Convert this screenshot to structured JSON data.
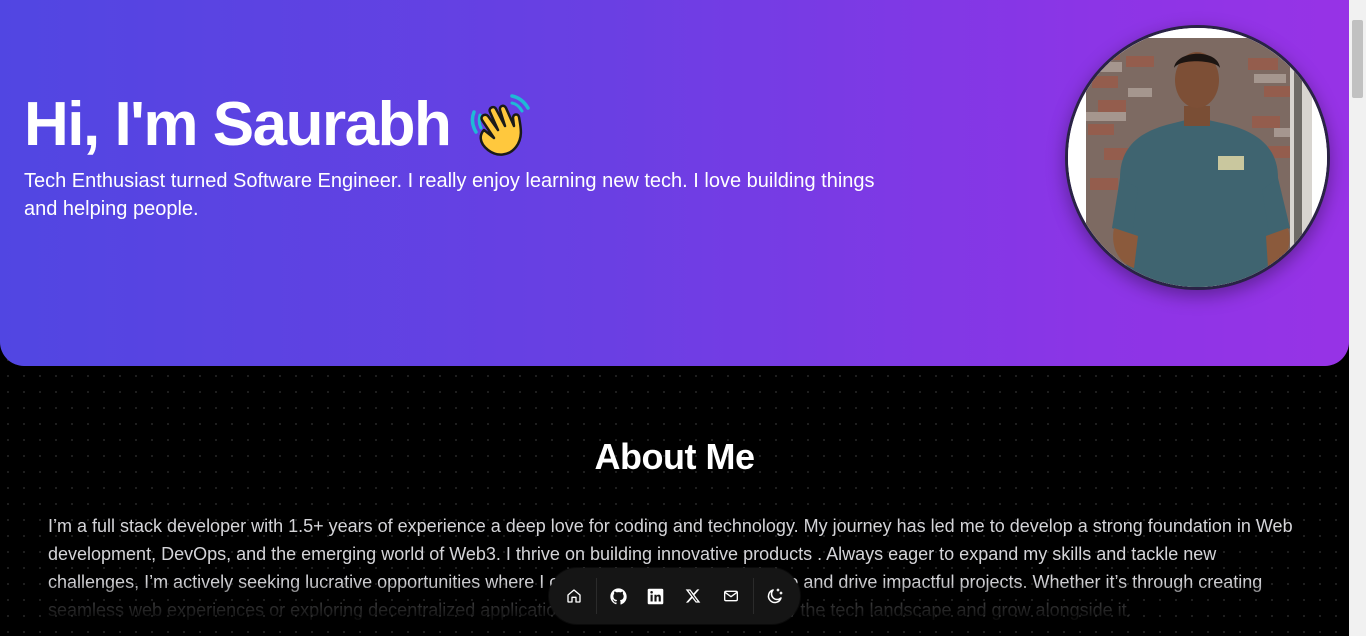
{
  "hero": {
    "title": "Hi, I'm Saurabh",
    "subtitle": "Tech Enthusiast turned Software Engineer. I really enjoy learning new tech. I love building things and helping people."
  },
  "about": {
    "title": "About Me",
    "paragraph": "I’m a full stack developer with 1.5+ years of experience a deep love for coding and technology. My journey has led me to develop a strong foundation in Web development, DevOps, and the emerging world of Web3. I thrive on building innovative products . Always eager to expand my skills and tackle new challenges, I’m actively seeking lucrative opportunities where I can leverage my tech expertise and drive impactful projects. Whether it’s through creating seamless web experiences or exploring decentralized applications, I’m excited to contribute to the tech landscape and grow alongside it."
  },
  "dock": {
    "items": [
      "home-icon",
      "github-icon",
      "linkedin-icon",
      "x-icon",
      "mail-icon",
      "theme-toggle-icon"
    ]
  },
  "colors": {
    "hero_gradient_start": "#5146e2",
    "hero_gradient_end": "#9733e6",
    "background": "#000000",
    "dock_background": "#151515"
  }
}
